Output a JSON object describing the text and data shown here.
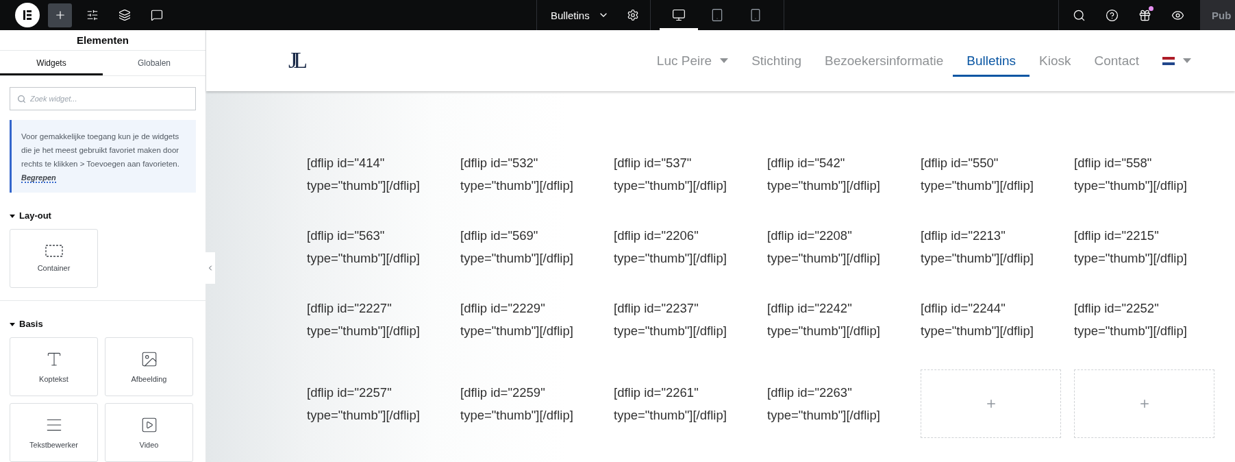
{
  "topbar": {
    "tools": [
      {
        "selected": false
      },
      {
        "selected": true
      },
      {
        "selected": false
      },
      {
        "selected": false
      },
      {
        "selected": false
      }
    ],
    "page_menu": {
      "label": "Bulletins"
    },
    "devices": [
      {
        "selected": true
      },
      {
        "selected": false
      },
      {
        "selected": false
      }
    ],
    "actions": [
      {
        "badge": false
      },
      {
        "badge": false
      },
      {
        "badge": true
      },
      {
        "badge": false
      }
    ],
    "publish": {
      "label": "Pub"
    }
  },
  "panel": {
    "title": "Elementen",
    "tabs": [
      {
        "label": "Widgets",
        "selected": true
      },
      {
        "label": "Globalen",
        "selected": false
      }
    ],
    "search": {
      "placeholder": "Zoek widget..."
    },
    "notice": {
      "text": "Voor gemakkelijke toegang kun je de widgets die je het meest gebruikt favoriet maken door rechts te klikken > Toevoegen aan favorieten.",
      "link": "Begrepen"
    },
    "categories": [
      {
        "label": "Lay-out",
        "expanded": true,
        "widgets": [
          {
            "label": "Container"
          }
        ]
      },
      {
        "label": "Basis",
        "expanded": true,
        "widgets": [
          {
            "label": "Koptekst"
          },
          {
            "label": "Afbeelding"
          },
          {
            "label": "Tekstbewerker"
          },
          {
            "label": "Video"
          }
        ]
      }
    ]
  },
  "site": {
    "logo": "JL",
    "nav": [
      {
        "label": "Luc Peire",
        "selected": false,
        "dropdown": true
      },
      {
        "label": "Stichting",
        "selected": false,
        "dropdown": false
      },
      {
        "label": "Bezoekersinformatie",
        "selected": false,
        "dropdown": false
      },
      {
        "label": "Bulletins",
        "selected": true,
        "dropdown": false
      },
      {
        "label": "Kiosk",
        "selected": false,
        "dropdown": false
      },
      {
        "label": "Contact",
        "selected": false,
        "dropdown": false
      }
    ],
    "cells": [
      {
        "kind": "shortcode",
        "text": "[dflip id=\"414\" type=\"thumb\"][/dflip]"
      },
      {
        "kind": "shortcode",
        "text": "[dflip id=\"532\" type=\"thumb\"][/dflip]"
      },
      {
        "kind": "shortcode",
        "text": "[dflip id=\"537\" type=\"thumb\"][/dflip]"
      },
      {
        "kind": "shortcode",
        "text": "[dflip id=\"542\" type=\"thumb\"][/dflip]"
      },
      {
        "kind": "shortcode",
        "text": "[dflip id=\"550\" type=\"thumb\"][/dflip]"
      },
      {
        "kind": "shortcode",
        "text": "[dflip id=\"558\" type=\"thumb\"][/dflip]"
      },
      {
        "kind": "shortcode",
        "text": "[dflip id=\"563\" type=\"thumb\"][/dflip]"
      },
      {
        "kind": "shortcode",
        "text": "[dflip id=\"569\" type=\"thumb\"][/dflip]"
      },
      {
        "kind": "shortcode",
        "text": "[dflip id=\"2206\" type=\"thumb\"][/dflip]"
      },
      {
        "kind": "shortcode",
        "text": "[dflip id=\"2208\" type=\"thumb\"][/dflip]"
      },
      {
        "kind": "shortcode",
        "text": "[dflip id=\"2213\" type=\"thumb\"][/dflip]"
      },
      {
        "kind": "shortcode",
        "text": "[dflip id=\"2215\" type=\"thumb\"][/dflip]"
      },
      {
        "kind": "shortcode",
        "text": "[dflip id=\"2227\" type=\"thumb\"][/dflip]"
      },
      {
        "kind": "shortcode",
        "text": "[dflip id=\"2229\" type=\"thumb\"][/dflip]"
      },
      {
        "kind": "shortcode",
        "text": "[dflip id=\"2237\" type=\"thumb\"][/dflip]"
      },
      {
        "kind": "shortcode",
        "text": "[dflip id=\"2242\" type=\"thumb\"][/dflip]"
      },
      {
        "kind": "shortcode",
        "text": "[dflip id=\"2244\" type=\"thumb\"][/dflip]"
      },
      {
        "kind": "shortcode",
        "text": "[dflip id=\"2252\" type=\"thumb\"][/dflip]"
      },
      {
        "kind": "shortcode",
        "text": "[dflip id=\"2257\" type=\"thumb\"][/dflip]"
      },
      {
        "kind": "shortcode",
        "text": "[dflip id=\"2259\" type=\"thumb\"][/dflip]"
      },
      {
        "kind": "shortcode",
        "text": "[dflip id=\"2261\" type=\"thumb\"][/dflip]"
      },
      {
        "kind": "shortcode",
        "text": "[dflip id=\"2263\" type=\"thumb\"][/dflip]"
      },
      {
        "kind": "empty"
      },
      {
        "kind": "empty"
      }
    ]
  }
}
